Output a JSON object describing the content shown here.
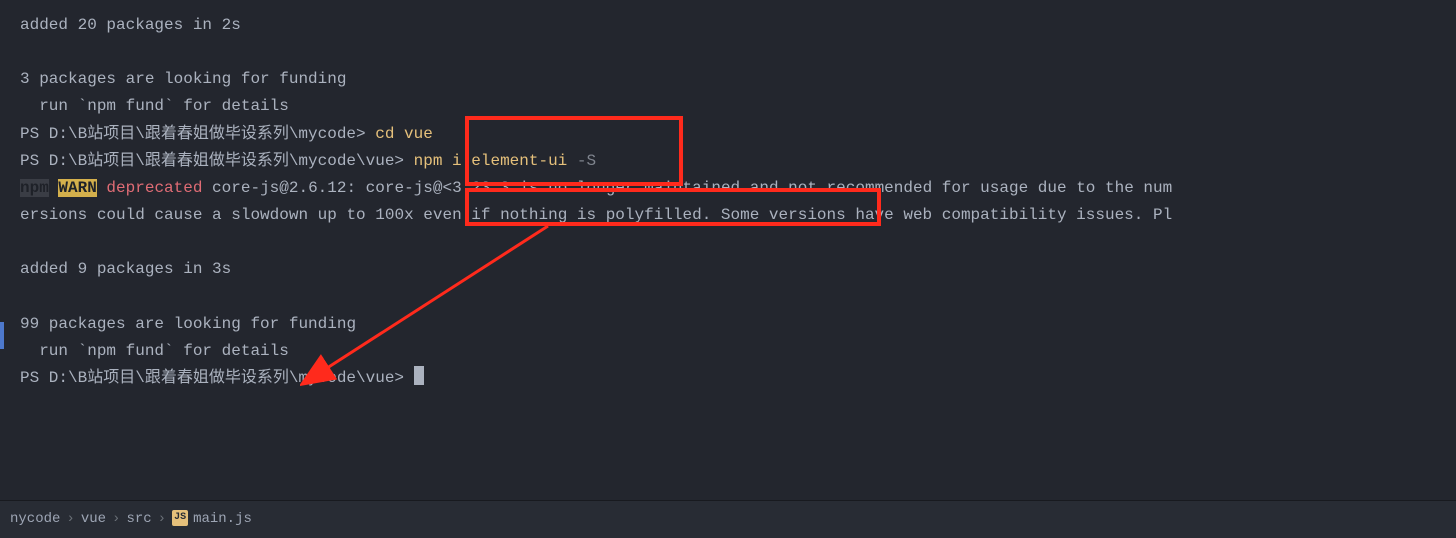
{
  "terminal": {
    "line1": "added 20 packages in 2s",
    "line2": "3 packages are looking for funding",
    "line3": "  run `npm fund` for details",
    "prompt1": "PS D:\\B站项目\\跟着春姐做毕设系列\\mycode>",
    "cmd1": " cd vue",
    "prompt2": "PS D:\\B站项目\\跟着春姐做毕设系列\\mycode\\vue>",
    "cmd2": " npm i element-ui ",
    "cmd2_flag": "-S",
    "npm_label": "npm",
    "warn_label": "WARN",
    "deprecated_label": " deprecated",
    "warn_text1": " core-js@2.6.12: core-js@<3.23.3 is no longer maintained and not recommended for usage due to the num",
    "warn_text2": "ersions could cause a slowdown up to 100x even if nothing is polyfilled. Some versions have web compatibility issues. Pl",
    "line4": "added 9 packages in 3s",
    "line5": "99 packages are looking for funding",
    "line6": "  run `npm fund` for details",
    "prompt3": "PS D:\\B站项目\\跟着春姐做毕设系列\\mycode\\vue> "
  },
  "breadcrumb": {
    "item1": "nycode",
    "item2": "vue",
    "item3": "src",
    "item4_icon": "JS",
    "item4": "main.js",
    "sep": "›"
  }
}
